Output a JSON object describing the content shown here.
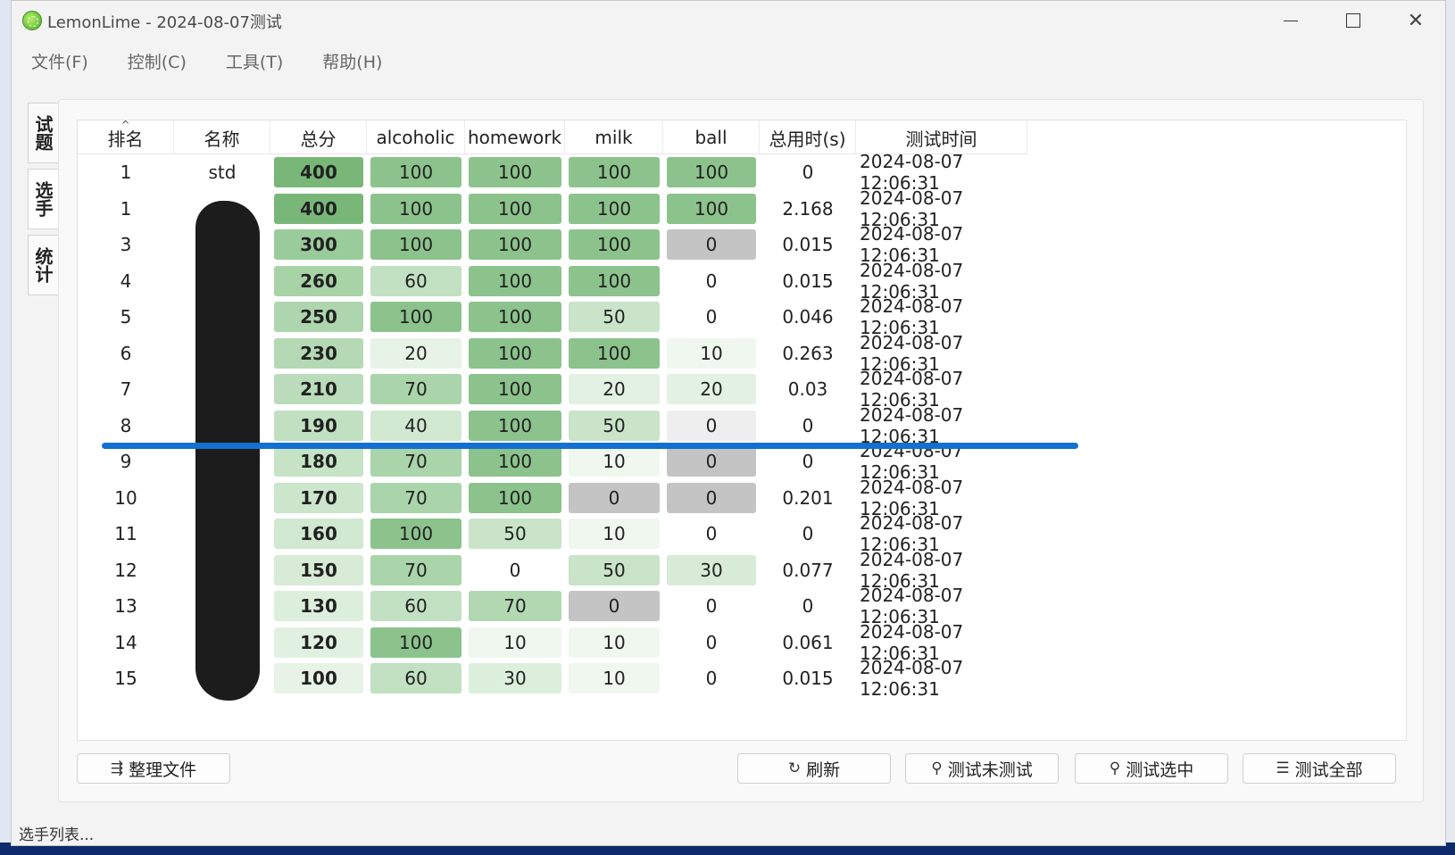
{
  "window": {
    "title": "LemonLime - 2024-08-07测试"
  },
  "menu": [
    "文件(F)",
    "控制(C)",
    "工具(T)",
    "帮助(H)"
  ],
  "side_tabs": [
    "试题",
    "选手",
    "统计"
  ],
  "table": {
    "columns": [
      "排名",
      "名称",
      "总分",
      "alcoholic",
      "homework",
      "milk",
      "ball",
      "总用时(s)",
      "测试时间"
    ],
    "rows": [
      [
        "1",
        "std",
        "400",
        "100",
        "100",
        "100",
        "100",
        "0",
        "2024-08-07 12:06:31"
      ],
      [
        "1",
        "",
        "400",
        "100",
        "100",
        "100",
        "100",
        "2.168",
        "2024-08-07 12:06:31"
      ],
      [
        "3",
        "",
        "300",
        "100",
        "100",
        "100",
        "0",
        "0.015",
        "2024-08-07 12:06:31"
      ],
      [
        "4",
        "",
        "260",
        "60",
        "100",
        "100",
        "0",
        "0.015",
        "2024-08-07 12:06:31"
      ],
      [
        "5",
        "",
        "250",
        "100",
        "100",
        "50",
        "0",
        "0.046",
        "2024-08-07 12:06:31"
      ],
      [
        "6",
        "",
        "230",
        "20",
        "100",
        "100",
        "10",
        "0.263",
        "2024-08-07 12:06:31"
      ],
      [
        "7",
        "",
        "210",
        "70",
        "100",
        "20",
        "20",
        "0.03",
        "2024-08-07 12:06:31"
      ],
      [
        "8",
        "",
        "190",
        "40",
        "100",
        "50",
        "0",
        "0",
        "2024-08-07 12:06:31"
      ],
      [
        "9",
        "",
        "180",
        "70",
        "100",
        "10",
        "0",
        "0",
        "2024-08-07 12:06:31"
      ],
      [
        "10",
        "",
        "170",
        "70",
        "100",
        "0",
        "0",
        "0.201",
        "2024-08-07 12:06:31"
      ],
      [
        "11",
        "",
        "160",
        "100",
        "50",
        "10",
        "0",
        "0",
        "2024-08-07 12:06:31"
      ],
      [
        "12",
        "",
        "150",
        "70",
        "0",
        "50",
        "30",
        "0.077",
        "2024-08-07 12:06:31"
      ],
      [
        "13",
        "",
        "130",
        "60",
        "70",
        "0",
        "0",
        "0",
        "2024-08-07 12:06:31"
      ],
      [
        "14",
        "",
        "120",
        "100",
        "10",
        "10",
        "0",
        "0.061",
        "2024-08-07 12:06:31"
      ],
      [
        "15",
        "",
        "100",
        "60",
        "30",
        "10",
        "0",
        "0.015",
        "2024-08-07 12:06:31"
      ]
    ],
    "cell_colors": [
      [
        "",
        "",
        "#79b779",
        "#8cc38c",
        "#8cc38c",
        "#8cc38c",
        "#8cc38c",
        "",
        ""
      ],
      [
        "",
        "",
        "#79b779",
        "#8cc38c",
        "#8cc38c",
        "#8cc38c",
        "#8cc38c",
        "",
        ""
      ],
      [
        "",
        "",
        "#9acb9a",
        "#8cc38c",
        "#8cc38c",
        "#8cc38c",
        "#c4c4c4",
        "",
        ""
      ],
      [
        "",
        "",
        "#a7d3a7",
        "#c2e0c2",
        "#8cc38c",
        "#8cc38c",
        "",
        "",
        ""
      ],
      [
        "",
        "",
        "#aed6ae",
        "#8cc38c",
        "#8cc38c",
        "#c9e4c9",
        "",
        "",
        ""
      ],
      [
        "",
        "",
        "#b4d9b4",
        "#e6f3e6",
        "#8cc38c",
        "#8cc38c",
        "#eff7ef",
        "",
        ""
      ],
      [
        "",
        "",
        "#badcba",
        "#aad4aa",
        "#8cc38c",
        "#e3f1e3",
        "#e3f1e3",
        "",
        ""
      ],
      [
        "",
        "",
        "#c1e0c1",
        "#d1e8d1",
        "#8cc38c",
        "#c9e4c9",
        "#eeeeee",
        "",
        ""
      ],
      [
        "",
        "",
        "#c6e3c6",
        "#aad4aa",
        "#8cc38c",
        "#eff7ef",
        "#c4c4c4",
        "",
        ""
      ],
      [
        "",
        "",
        "#cbe6cb",
        "#aad4aa",
        "#8cc38c",
        "#c4c4c4",
        "#c4c4c4",
        "",
        ""
      ],
      [
        "",
        "",
        "#d1e8d1",
        "#8cc38c",
        "#c9e4c9",
        "#eff7ef",
        "",
        "",
        ""
      ],
      [
        "",
        "",
        "#d7ebd7",
        "#aad4aa",
        "",
        "#c9e4c9",
        "#d7ebd7",
        "",
        ""
      ],
      [
        "",
        "",
        "#dcefdc",
        "#c2e0c2",
        "#b2d8b2",
        "#c4c4c4",
        "",
        "",
        ""
      ],
      [
        "",
        "",
        "#e1f1e1",
        "#8cc38c",
        "#eff7ef",
        "#eff7ef",
        "",
        "",
        ""
      ],
      [
        "",
        "",
        "#e6f3e6",
        "#c2e0c2",
        "#dcefdc",
        "#eff7ef",
        "",
        "",
        ""
      ]
    ]
  },
  "buttons": {
    "organize": "整理文件",
    "refresh": "刷新",
    "test_untested": "测试未测试",
    "test_selected": "测试选中",
    "test_all": "测试全部"
  },
  "status": "选手列表..."
}
